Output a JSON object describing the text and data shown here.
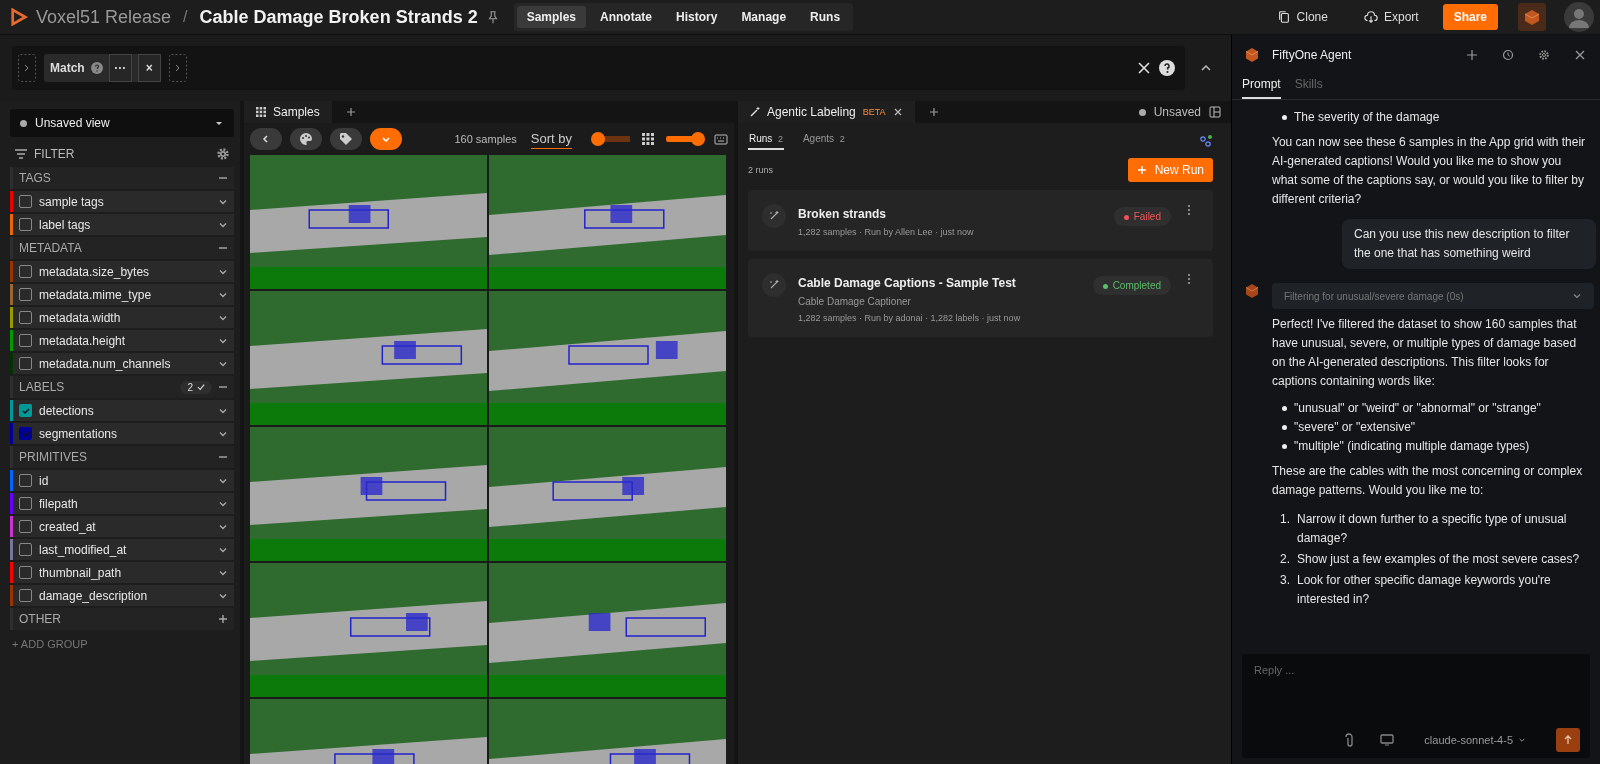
{
  "header": {
    "brand": "Voxel51 Release",
    "separator": "/",
    "title": "Cable Damage Broken Strands 2",
    "nav": [
      {
        "label": "Samples",
        "selected": true
      },
      {
        "label": "Annotate",
        "selected": false
      },
      {
        "label": "History",
        "selected": false
      },
      {
        "label": "Manage",
        "selected": false
      },
      {
        "label": "Runs",
        "selected": false
      }
    ],
    "actions": [
      {
        "label": "Clone",
        "kind": "clone"
      },
      {
        "label": "Export",
        "kind": "export"
      },
      {
        "label": "Share",
        "kind": "primary"
      }
    ]
  },
  "view_bar": {
    "stage": "Match",
    "more": "···",
    "remove": "×"
  },
  "sidebar": {
    "view": "Unsaved view",
    "filter_label": "FILTER",
    "add_group": "+ ADD GROUP",
    "groups": [
      {
        "title": "TAGS",
        "expanded": true,
        "items": [
          {
            "label": "sample tags",
            "color": "#ee0000",
            "checked": false
          },
          {
            "label": "label tags",
            "color": "#ee6600",
            "checked": false
          }
        ]
      },
      {
        "title": "METADATA",
        "expanded": true,
        "items": [
          {
            "label": "metadata.size_bytes",
            "color": "#993300",
            "checked": false
          },
          {
            "label": "metadata.mime_type",
            "color": "#996633",
            "checked": false
          },
          {
            "label": "metadata.width",
            "color": "#999900",
            "checked": false
          },
          {
            "label": "metadata.height",
            "color": "#009900",
            "checked": false
          },
          {
            "label": "metadata.num_channels",
            "color": "#003300",
            "checked": false
          }
        ]
      },
      {
        "title": "LABELS",
        "expanded": true,
        "badge": "2",
        "items": [
          {
            "label": "detections",
            "color": "#009999",
            "checked": true
          },
          {
            "label": "segmentations",
            "color": "#000099",
            "checked": true
          }
        ]
      },
      {
        "title": "PRIMITIVES",
        "expanded": true,
        "items": [
          {
            "label": "id",
            "color": "#0066ff",
            "checked": false
          },
          {
            "label": "filepath",
            "color": "#6600ff",
            "checked": false
          },
          {
            "label": "created_at",
            "color": "#cc33cc",
            "checked": false
          },
          {
            "label": "last_modified_at",
            "color": "#777799",
            "checked": false
          },
          {
            "label": "thumbnail_path",
            "color": "#ff0000",
            "checked": false
          },
          {
            "label": "damage_description",
            "color": "#993300",
            "checked": false
          }
        ]
      },
      {
        "title": "OTHER",
        "expanded": false
      }
    ]
  },
  "grid": {
    "tab": "Samples",
    "count": "160 samples",
    "sort": "Sort by",
    "sliders": [
      {
        "level": 0.1
      },
      {
        "level": 0.9
      }
    ]
  },
  "agentic": {
    "tab": "Agentic Labeling",
    "tag": "BETA",
    "status": "Unsaved",
    "subtabs": [
      {
        "label": "Runs",
        "count": "2",
        "selected": true
      },
      {
        "label": "Agents",
        "count": "2",
        "selected": false
      }
    ],
    "total": "2 runs",
    "new_run": "New Run",
    "runs": [
      {
        "title": "Broken strands",
        "meta": "1,282 samples · Run by Allen Lee · just now",
        "status": "Failed",
        "kind": "failed"
      },
      {
        "title": "Cable Damage Captions - Sample Test",
        "subtitle": "Cable Damage Captioner",
        "meta": "1,282 samples · Run by adonai · 1,282 labels · just now",
        "status": "Completed",
        "kind": "completed"
      }
    ]
  },
  "agent": {
    "title": "FiftyOne Agent",
    "tabs": [
      {
        "label": "Prompt",
        "selected": true
      },
      {
        "label": "Skills",
        "selected": false
      }
    ],
    "messages": [
      {
        "kind": "bullets",
        "items": [
          "The severity of the damage"
        ]
      },
      {
        "kind": "text",
        "text": "You can now see these 6 samples in the App grid with their AI-generated captions! Would you like me to show you what some of the captions say, or would you like to filter by different criteria?"
      },
      {
        "kind": "user",
        "text": "Can you use this new description to filter the one that has something weird"
      },
      {
        "kind": "tool",
        "text": "Filtering for unusual/severe damage (0s)"
      },
      {
        "kind": "text",
        "text": "Perfect! I've filtered the dataset to show 160 samples that have unusual, severe, or multiple types of damage based on the AI-generated descriptions. This filter looks for captions containing words like:"
      },
      {
        "kind": "bullets",
        "items": [
          "\"unusual\" or \"weird\" or \"abnormal\" or \"strange\"",
          "\"severe\" or \"extensive\"",
          "\"multiple\" (indicating multiple damage types)"
        ]
      },
      {
        "kind": "text",
        "text": "These are the cables with the most concerning or complex damage patterns. Would you like me to:"
      },
      {
        "kind": "numbered",
        "items": [
          {
            "marker": "1.",
            "text": "Narrow it down further to a specific type of unusual damage?"
          },
          {
            "marker": "2.",
            "text": "Show just a few examples of the most severe cases?"
          },
          {
            "marker": "3.",
            "text": "Look for other specific damage keywords you're interested in?"
          }
        ]
      }
    ],
    "reply": {
      "placeholder": "Reply ...",
      "model": "claude-sonnet-4-5"
    }
  }
}
